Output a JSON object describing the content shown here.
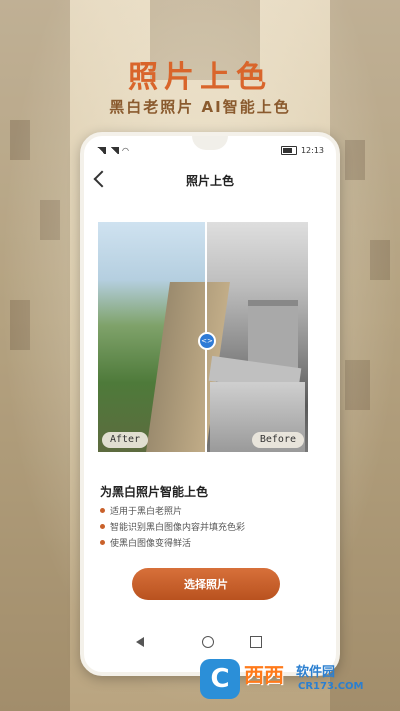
{
  "banner": {
    "headline": "照片上色",
    "subline": "黑白老照片 AI智能上色"
  },
  "status_bar": {
    "time": "12:13"
  },
  "nav": {
    "title": "照片上色"
  },
  "compare": {
    "after_label": "After",
    "before_label": "Before",
    "handle_symbol": "<>"
  },
  "features": {
    "title": "为黑白照片智能上色",
    "items": [
      "适用于黑白老照片",
      "智能识别黑白图像内容并填充色彩",
      "使黑白图像变得鲜活"
    ]
  },
  "cta": {
    "label": "选择照片"
  },
  "watermark": {
    "logo_letter": "C",
    "name": "西西",
    "slogan": "软件园",
    "domain": "CR173.COM"
  },
  "colors": {
    "accent": "#d9652b",
    "button": "#c9612b",
    "slider_handle": "#2f7bd6"
  }
}
